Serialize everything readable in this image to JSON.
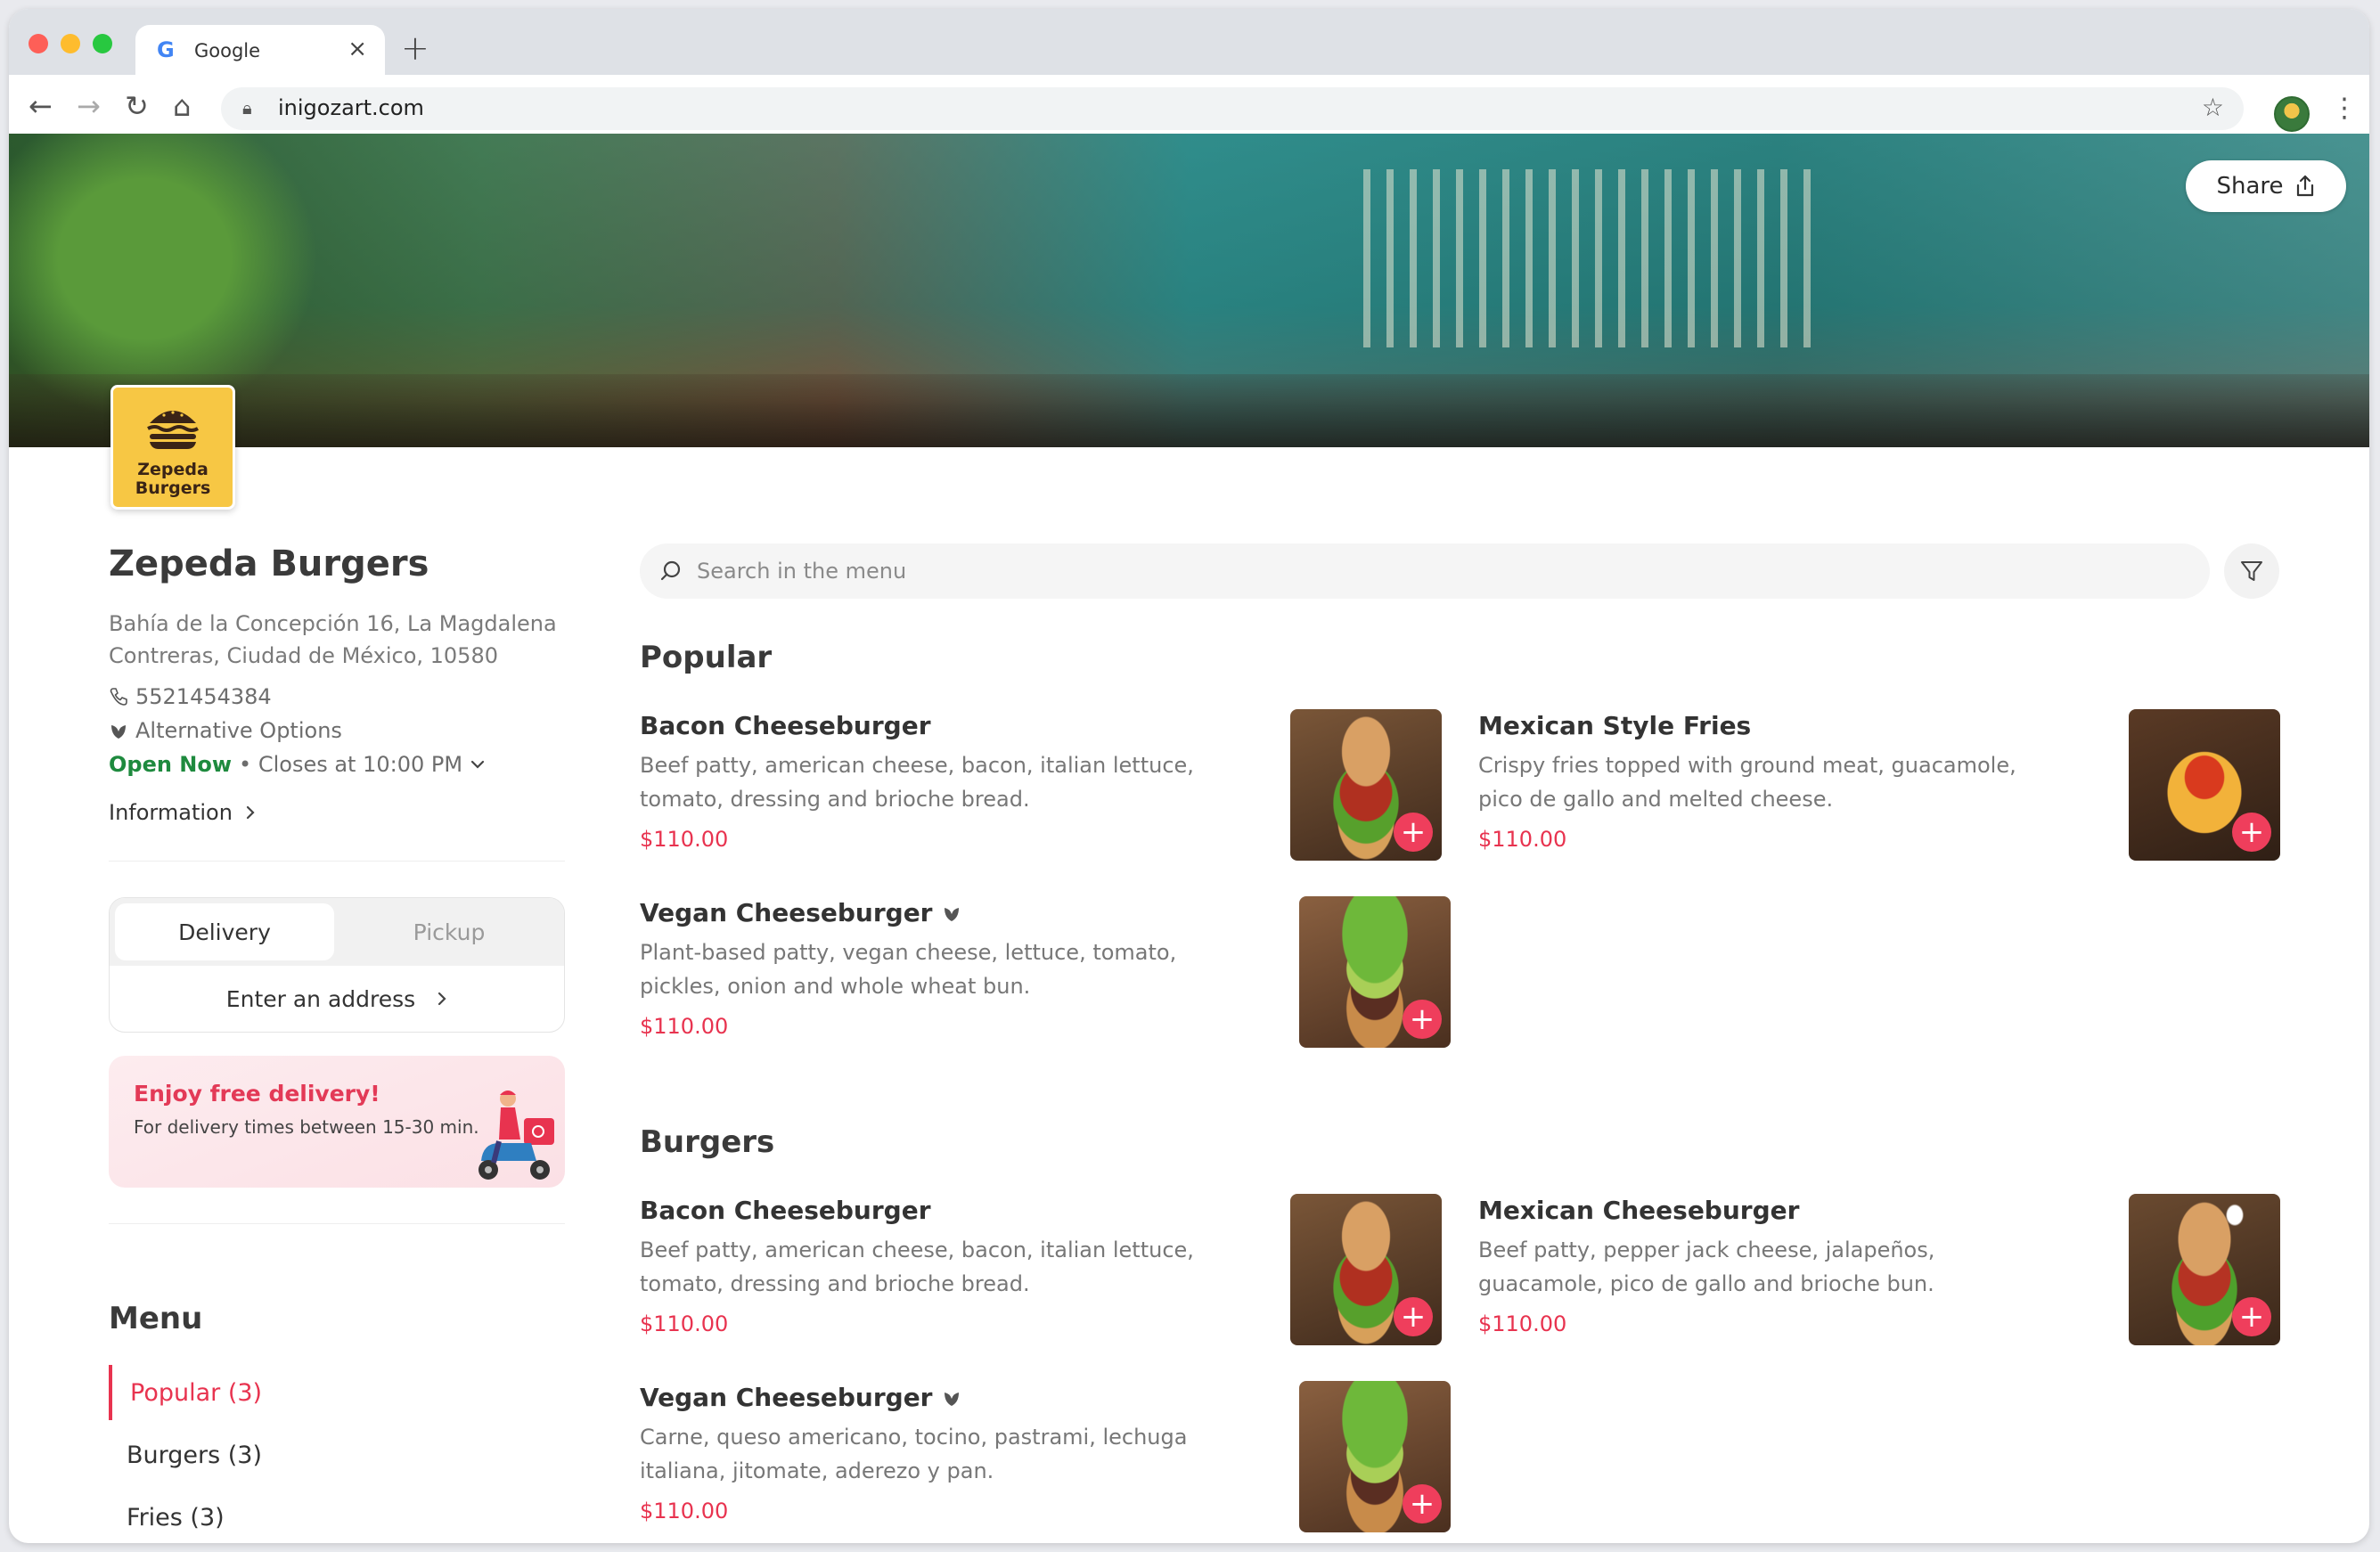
{
  "browser": {
    "tab_title": "Google",
    "url": "inigozart.com"
  },
  "banner": {
    "share_label": "Share"
  },
  "restaurant": {
    "logo_line1": "Zepeda",
    "logo_line2": "Burgers",
    "name": "Zepeda Burgers",
    "address": "Bahía de la Concepción 16, La Magdalena Contreras, Ciudad de México, 10580",
    "phone": "5521454384",
    "options": "Alternative Options",
    "open_status": "Open Now",
    "closing": "• Closes at 10:00 PM",
    "info_label": "Information"
  },
  "order": {
    "tabs": [
      "Delivery",
      "Pickup"
    ],
    "address_cta": "Enter an address"
  },
  "promo": {
    "title": "Enjoy free delivery!",
    "text": "For delivery times between 15-30 min."
  },
  "menu_nav": {
    "title": "Menu",
    "items": [
      "Popular (3)",
      "Burgers (3)",
      "Fries (3)"
    ]
  },
  "search": {
    "placeholder": "Search in the menu"
  },
  "sections": [
    {
      "title": "Popular",
      "items": [
        {
          "name": "Bacon Cheeseburger",
          "desc": "Beef patty, american cheese, bacon, italian lettuce, tomato, dressing and brioche bread.",
          "price": "$110.00"
        },
        {
          "name": "Mexican Style Fries",
          "desc": "Crispy fries topped with ground meat, guacamole, pico de gallo and melted cheese.",
          "price": "$110.00"
        },
        {
          "name": "Vegan Cheeseburger",
          "desc": "Plant-based patty, vegan cheese, lettuce, tomato, pickles, onion and whole wheat bun.",
          "price": "$110.00"
        }
      ]
    },
    {
      "title": "Burgers",
      "items": [
        {
          "name": "Bacon Cheeseburger",
          "desc": "Beef patty, american cheese, bacon, italian lettuce, tomato, dressing and brioche bread.",
          "price": "$110.00"
        },
        {
          "name": "Mexican Cheeseburger",
          "desc": "Beef patty, pepper jack cheese, jalapeños, guacamole, pico de gallo and brioche bun.",
          "price": "$110.00"
        },
        {
          "name": "Vegan Cheeseburger",
          "desc": "Carne, queso americano, tocino, pastrami, lechuga italiana, jitomate, aderezo y pan.",
          "price": "$110.00"
        }
      ]
    }
  ],
  "colors": {
    "accent": "#e8334f",
    "open": "#1e8a3e",
    "logo_bg": "#f7c744"
  },
  "icons": [
    "google-icon",
    "close-icon",
    "plus-icon",
    "back-icon",
    "forward-icon",
    "reload-icon",
    "home-icon",
    "lock-icon",
    "star-icon",
    "kebab-icon",
    "share-icon",
    "phone-icon",
    "leaf-icon",
    "chevron-down-icon",
    "chevron-right-icon",
    "search-icon",
    "filter-icon",
    "add-icon"
  ]
}
